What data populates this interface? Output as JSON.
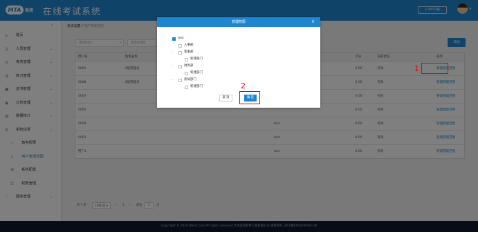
{
  "header": {
    "logo_mark": "MTA",
    "logo_text": "美塔",
    "title": "在线考试系统",
    "app_download": "APP下载"
  },
  "sidebar": {
    "items": [
      {
        "label": "首页",
        "icon": "home-icon",
        "glyph": "⌂",
        "has_children": false
      },
      {
        "label": "人员管理",
        "icon": "user-icon",
        "glyph": "♙",
        "has_children": true
      },
      {
        "label": "考务管理",
        "icon": "exam-icon",
        "glyph": "◎",
        "has_children": true
      },
      {
        "label": "练习管理",
        "icon": "practice-icon",
        "glyph": "◔",
        "has_children": true
      },
      {
        "label": "证书管理",
        "icon": "certificate-icon",
        "glyph": "▣",
        "has_children": true
      },
      {
        "label": "公告管理",
        "icon": "notice-icon",
        "glyph": "◉",
        "has_children": true
      },
      {
        "label": "数据统计",
        "icon": "stats-icon",
        "glyph": "▤",
        "has_children": true
      },
      {
        "label": "系统设置",
        "icon": "settings-icon",
        "glyph": "⚙",
        "has_children": true
      },
      {
        "label": "角色权限",
        "icon": "role-icon",
        "glyph": "♘",
        "sub": true
      },
      {
        "label": "用户管理范围",
        "icon": "user-scope-icon",
        "glyph": "♗",
        "sub": true,
        "active": true
      },
      {
        "label": "系统配置",
        "icon": "config-icon",
        "glyph": "⚒",
        "sub": true
      },
      {
        "label": "权限管理",
        "icon": "permission-icon",
        "glyph": "⚿",
        "sub": true
      },
      {
        "label": "题库管理",
        "icon": "question-bank-icon",
        "glyph": "♡",
        "has_children": true
      }
    ]
  },
  "breadcrumb": {
    "parent": "系统设置",
    "separator": "/",
    "current": "用户管理范围"
  },
  "filters": {
    "dept": "请选择部门",
    "role": "请选择角色"
  },
  "add_button": "添加",
  "table": {
    "columns": [
      "用户名",
      "角色名称",
      "",
      "",
      "",
      "学分",
      "在职状态",
      "",
      "操作"
    ],
    "rows": [
      [
        "0009",
        "2级管理员",
        "",
        "",
        "",
        "0.00",
        "有效",
        "",
        "管理管理范围"
      ],
      [
        "0008",
        "2级管理员",
        "",
        "",
        "",
        "0.00",
        "有效",
        "",
        "管理管理范围"
      ],
      [
        "0007",
        "",
        "",
        "",
        "",
        "0.00",
        "有效",
        "",
        "管理管理范围"
      ],
      [
        "0005",
        "",
        "",
        "",
        "",
        "0.00",
        "有效",
        "",
        "管理管理范围"
      ],
      [
        "0004",
        "",
        "",
        "",
        "test",
        "0.00",
        "有效",
        "",
        "管理管理范围"
      ],
      [
        "0003",
        "",
        "",
        "",
        "test",
        "0.00",
        "有效",
        "",
        "管理管理范围"
      ],
      [
        "用户1",
        "",
        "",
        "",
        "test",
        "0.00",
        "有效",
        "",
        "管理管理范围"
      ]
    ]
  },
  "pagination": {
    "total": "共 7 条",
    "page_size": "10条/页",
    "prev": "‹",
    "page": "1",
    "next": "›",
    "goto": "前往",
    "goto_value": "1",
    "page_unit": "页"
  },
  "footer": "Copyright © 2019 8tech.com All rights reserved 大连美塔软件工程有限公司 版权所有 辽ICP备09020469号-19",
  "modal": {
    "title": "管理权限",
    "close": "×",
    "tree": [
      {
        "label": "test",
        "level": 0,
        "checked": true,
        "toggle": ""
      },
      {
        "label": "人事部",
        "level": 1,
        "checked": false,
        "toggle": ""
      },
      {
        "label": "客服部",
        "level": 1,
        "checked": false,
        "toggle": "⌄"
      },
      {
        "label": "新建部门",
        "level": 2,
        "checked": false,
        "toggle": ""
      },
      {
        "label": "财务部",
        "level": 1,
        "checked": false,
        "toggle": "⌄"
      },
      {
        "label": "新建部门",
        "level": 2,
        "checked": false,
        "toggle": ""
      },
      {
        "label": "测试部门",
        "level": 1,
        "checked": false,
        "toggle": "⌄"
      },
      {
        "label": "新建部门",
        "level": 2,
        "checked": false,
        "toggle": ""
      }
    ],
    "cancel": "取 消",
    "ok": "确 定"
  },
  "annotations": {
    "one": "1",
    "two": "2"
  },
  "colors": {
    "primary": "#1f86d1",
    "annotation": "#e60000",
    "footer_bg": "#0f1a2d"
  }
}
